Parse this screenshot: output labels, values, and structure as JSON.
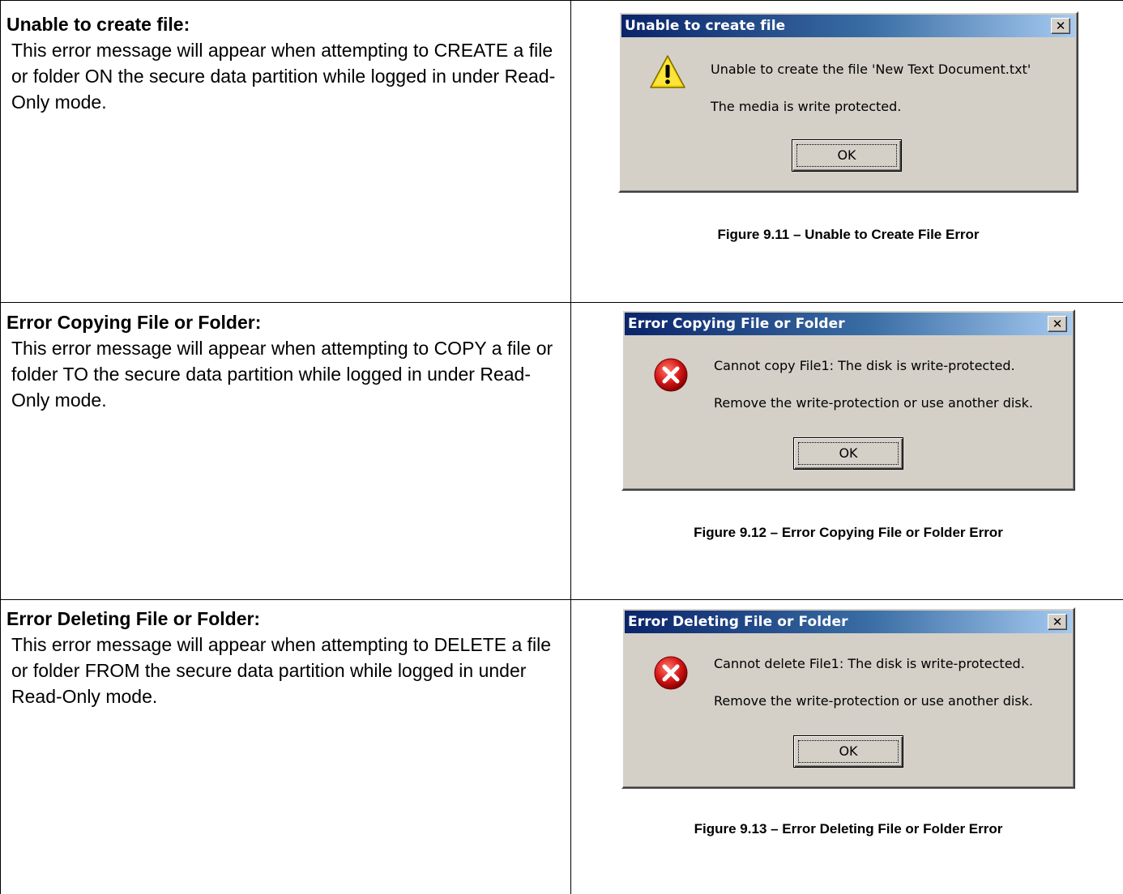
{
  "rows": [
    {
      "heading": "Unable to create file:",
      "description": "This error message will appear when attempting to CREATE a file or folder ON the secure data partition while logged in under Read-Only mode.",
      "dialog": {
        "title": "Unable to create file",
        "icon": "warning-icon",
        "message_line1": "Unable to create the file 'New Text Document.txt'",
        "message_line2": "The media is write protected.",
        "button_label": "OK",
        "close_glyph": "✕"
      },
      "caption": "Figure 9.11 – Unable to Create File Error"
    },
    {
      "heading": "Error Copying File or Folder:",
      "description": "This error message will appear when attempting to COPY a file or folder TO the secure data partition while logged in under Read-Only mode.",
      "dialog": {
        "title": "Error Copying File or Folder",
        "icon": "error-icon",
        "message_line1": "Cannot copy File1: The disk is write-protected.",
        "message_line2": "Remove the write-protection or use another disk.",
        "button_label": "OK",
        "close_glyph": "✕"
      },
      "caption": "Figure 9.12 – Error Copying File or Folder Error"
    },
    {
      "heading": "Error Deleting File or Folder:",
      "description": "This error message will appear when attempting to DELETE a file or folder FROM the secure data partition while logged in under Read-Only mode.",
      "dialog": {
        "title": "Error Deleting File or Folder",
        "icon": "error-icon",
        "message_line1": "Cannot delete File1: The disk is write-protected.",
        "message_line2": "Remove the write-protection or use another disk.",
        "button_label": "OK",
        "close_glyph": "✕"
      },
      "caption": "Figure 9.13 – Error Deleting File or Folder Error"
    }
  ],
  "colors": {
    "dialog_face": "#d4d0c8",
    "titlebar_start": "#0a246a",
    "titlebar_end": "#a6caf0",
    "warning_yellow": "#f8d800",
    "error_red": "#d81818"
  }
}
